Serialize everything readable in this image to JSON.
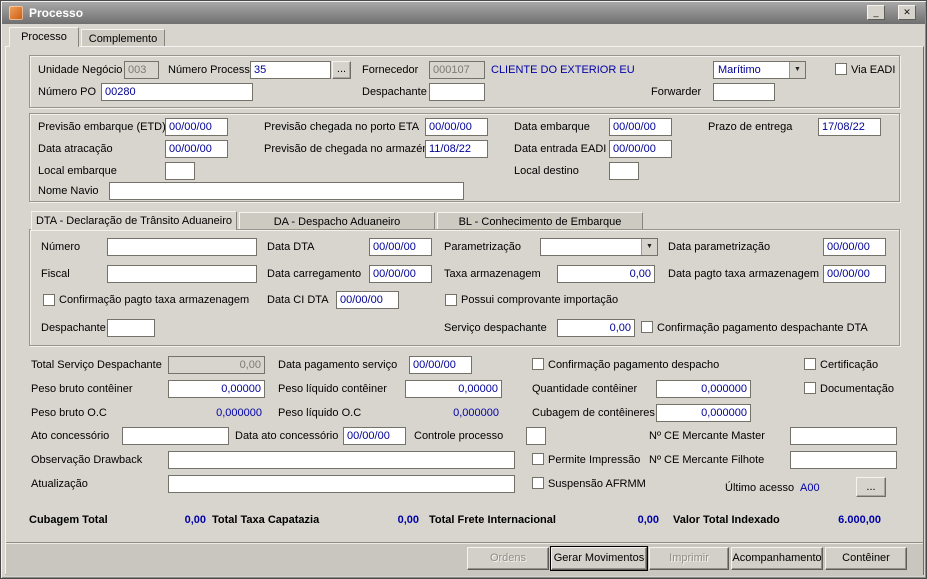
{
  "window": {
    "title": "Processo",
    "minimize_icon": "_",
    "close_icon": "✕"
  },
  "main_tabs": {
    "processo": "Processo",
    "complemento": "Complemento"
  },
  "header": {
    "unidade_negocio": {
      "label": "Unidade Negócio",
      "value": "003"
    },
    "numero_processo": {
      "label": "Número Processo",
      "value": "35"
    },
    "browse": "...",
    "fornecedor": {
      "label": "Fornecedor",
      "code": "000107",
      "name": "CLIENTE DO EXTERIOR EU"
    },
    "modal": {
      "value": "Marítimo",
      "arrow_icon": "▼"
    },
    "via_eadi": {
      "label": "Via EADI",
      "checked": false
    },
    "numero_po": {
      "label": "Número PO",
      "value": "00280"
    },
    "despachante": {
      "label": "Despachante",
      "value": ""
    },
    "forwarder": {
      "label": "Forwarder",
      "value": ""
    }
  },
  "schedule": {
    "previsao_embarque": {
      "label": "Previsão embarque (ETD)",
      "value": "00/00/00"
    },
    "previsao_chegada_porto": {
      "label": "Previsão chegada no porto ETA",
      "value": "00/00/00"
    },
    "data_embarque": {
      "label": "Data embarque",
      "value": "00/00/00"
    },
    "prazo_entrega": {
      "label": "Prazo de entrega",
      "value": "17/08/22"
    },
    "data_atracacao": {
      "label": "Data atracação",
      "value": "00/00/00"
    },
    "previsao_chegada_armazem": {
      "label": "Previsão de chegada no armazém",
      "value": "11/08/22"
    },
    "data_entrada_eadi": {
      "label": "Data entrada EADI",
      "value": "00/00/00"
    },
    "local_embarque": {
      "label": "Local embarque",
      "value": ""
    },
    "local_destino": {
      "label": "Local destino",
      "value": ""
    },
    "nome_navio": {
      "label": "Nome Navio",
      "value": ""
    }
  },
  "doc_tabs": {
    "dta": "DTA - Declaração de Trânsito Aduaneiro",
    "da": "DA - Despacho Aduaneiro",
    "bl": "BL - Conhecimento de Embarque"
  },
  "dta": {
    "numero": {
      "label": "Número",
      "value": ""
    },
    "data_dta": {
      "label": "Data DTA",
      "value": "00/00/00"
    },
    "parametrizacao": {
      "label": "Parametrização",
      "value": "",
      "arrow_icon": "▼"
    },
    "data_parametrizacao": {
      "label": "Data parametrização",
      "value": "00/00/00"
    },
    "fiscal": {
      "label": "Fiscal",
      "value": ""
    },
    "data_carregamento": {
      "label": "Data carregamento",
      "value": "00/00/00"
    },
    "taxa_armazenagem": {
      "label": "Taxa armazenagem",
      "value": "0,00"
    },
    "data_pagto_taxa": {
      "label": "Data pagto taxa armazenagem",
      "value": "00/00/00"
    },
    "confirm_pagto_taxa": {
      "label": "Confirmação pagto taxa armazenagem",
      "checked": false
    },
    "data_ci_dta": {
      "label": "Data CI DTA",
      "value": "00/00/00"
    },
    "possui_comprovante": {
      "label": "Possui comprovante importação",
      "checked": false
    },
    "despachante": {
      "label": "Despachante",
      "value": ""
    },
    "servico_despachante": {
      "label": "Serviço despachante",
      "value": "0,00"
    },
    "confirm_pag_despachante": {
      "label": "Confirmação pagamento despachante DTA",
      "checked": false
    }
  },
  "details": {
    "total_servico": {
      "label": "Total Serviço Despachante",
      "value": "0,00"
    },
    "data_pagamento_servico": {
      "label": "Data pagamento serviço",
      "value": "00/00/00"
    },
    "confirm_pag_despacho": {
      "label": "Confirmação pagamento despacho",
      "checked": false
    },
    "certificacao": {
      "label": "Certificação",
      "checked": false
    },
    "peso_bruto_conteiner": {
      "label": "Peso bruto contêiner",
      "value": "0,00000"
    },
    "peso_liquido_conteiner": {
      "label": "Peso líquido contêiner",
      "value": "0,00000"
    },
    "quantidade_conteiner": {
      "label": "Quantidade contêiner",
      "value": "0,000000"
    },
    "documentacao": {
      "label": "Documentação",
      "checked": false
    },
    "peso_bruto_oc": {
      "label": "Peso bruto O.C",
      "value": "0,000000"
    },
    "peso_liquido_oc": {
      "label": "Peso líquido O.C",
      "value": "0,000000"
    },
    "cubagem_conteineres": {
      "label": "Cubagem de contêineres",
      "value": "0,000000"
    },
    "ato_concessorio": {
      "label": "Ato concessório",
      "value": ""
    },
    "data_ato_concessorio": {
      "label": "Data ato concessório",
      "value": "00/00/00"
    },
    "controle_processo": {
      "label": "Controle processo",
      "value": ""
    },
    "ce_mercante_master": {
      "label": "Nº CE Mercante Master",
      "value": ""
    },
    "observacao_drawback": {
      "label": "Observação Drawback",
      "value": ""
    },
    "permite_impressao": {
      "label": "Permite Impressão",
      "checked": false
    },
    "ce_mercante_filhote": {
      "label": "Nº CE Mercante Filhote",
      "value": ""
    },
    "atualizacao": {
      "label": "Atualização",
      "value": ""
    },
    "suspensao_afrmm": {
      "label": "Suspensão AFRMM",
      "checked": false
    },
    "ultimo_acesso": {
      "label": "Último acesso",
      "value": "A00",
      "browse": "..."
    }
  },
  "totals": {
    "cubagem_total": {
      "label": "Cubagem Total",
      "value": "0,00"
    },
    "total_taxa_capatazia": {
      "label": "Total Taxa Capatazia",
      "value": "0,00"
    },
    "total_frete_internacional": {
      "label": "Total Frete Internacional",
      "value": "0,00"
    },
    "valor_total_indexado": {
      "label": "Valor Total Indexado",
      "value": "6.000,00"
    }
  },
  "buttons": {
    "ordens": "Ordens",
    "gerar_movimentos": "Gerar Movimentos",
    "imprimir": "Imprimir",
    "acompanhamento": "Acompanhamento",
    "conteiner": "Contêiner"
  }
}
